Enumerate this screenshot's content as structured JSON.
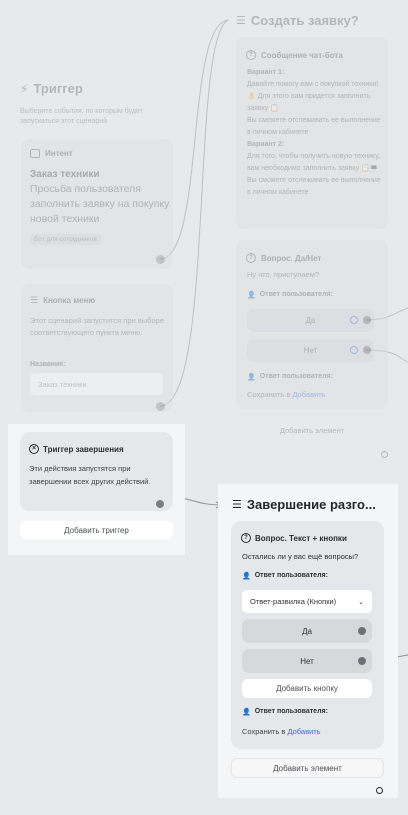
{
  "trigger_column": {
    "title": "Триггер",
    "description": "Выберите события, по которым будет запускаться этот сценарий",
    "intent_card": {
      "header": "Интент",
      "title": "Заказ техники",
      "body": "Просьба пользователя заполнить заявку на покупку новой техники",
      "tag": "Бот для сотрудников"
    },
    "menu_card": {
      "header": "Кнопка меню",
      "body": "Этот сценарий запустится при выборе соответствующего пункта меню.",
      "name_label": "Название:",
      "name_value": "Заказ техники"
    },
    "completion_card": {
      "header": "Триггер завершения",
      "body": "Эти действия запустятся при завершении всех других действий."
    },
    "add_trigger_label": "Добавить триггер"
  },
  "request_column": {
    "title": "Создать заявку?",
    "chat_message": {
      "header": "Сообщение чат-бота",
      "variant1_label": "Вариант 1:",
      "variant1_text_a": "Давайте помогу вам с покупкой техники! 👌 Для этого вам придется заполнить заявку 📋",
      "variant1_text_b": "Вы сможете отслеживать ее выполнение в личном кабинете",
      "variant2_label": "Вариант 2:",
      "variant2_text_a": "Для того, чтобы получить новую технику, вам необходимо заполнить заявку 📋💻",
      "variant2_text_b": "Вы сможете отслеживать ее выполнение в личном кабинете"
    },
    "yes_no": {
      "header": "Вопрос. Да/Нет",
      "question": "Ну что, приступаем?",
      "user_answer_label": "Ответ пользователя:",
      "yes": "Да",
      "no": "Нет",
      "user_answer_label_2": "Ответ пользователя:",
      "save_to": "Сохранить в",
      "add_link": "Добавить"
    },
    "add_element_label": "Добавить элемент"
  },
  "completion_column": {
    "title": "Завершение разго...",
    "question_card": {
      "header": "Вопрос. Текст + кнопки",
      "question": "Остались ли у вас ещё вопросы?",
      "user_answer_label": "Ответ пользователя:",
      "select_value": "Ответ-развилка (Кнопки)",
      "yes": "Да",
      "no": "Нет",
      "add_button_label": "Добавить кнопку",
      "user_answer_label_2": "Ответ пользователя:",
      "save_to": "Сохранить в",
      "add_link": "Добавить"
    },
    "add_element_label": "Добавить элемент"
  }
}
